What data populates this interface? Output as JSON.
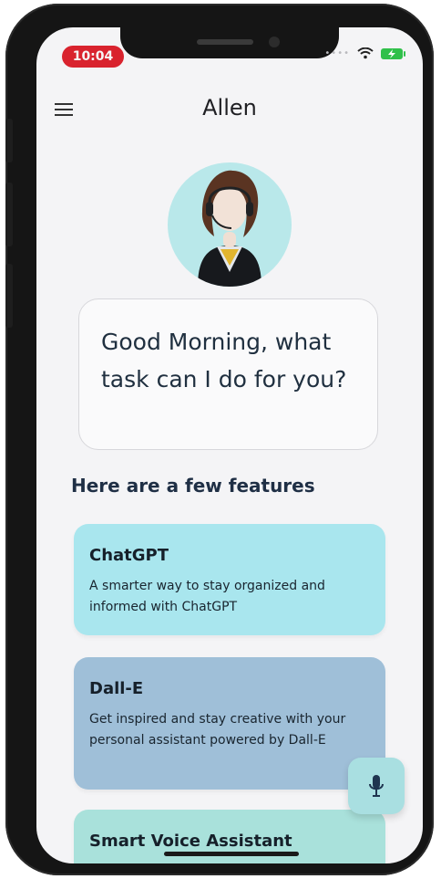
{
  "status_bar": {
    "time": "10:04",
    "battery_color": "#30C04A",
    "time_pill_color": "#D9232E",
    "icons": [
      "cellular-dots-icon",
      "wifi-icon",
      "battery-charging-icon"
    ]
  },
  "header": {
    "menu_icon": "hamburger-menu-icon",
    "title": "Allen"
  },
  "assistant": {
    "avatar_icon": "assistant-avatar-icon",
    "greeting": "Good Morning, what task can I do for you?"
  },
  "features": {
    "heading": "Here are a few features",
    "items": [
      {
        "title": "ChatGPT",
        "description": "A smarter way to stay organized and informed with ChatGPT",
        "color": "#A9E6EE"
      },
      {
        "title": "Dall-E",
        "description": "Get inspired and stay creative with your personal assistant powered by Dall-E",
        "color": "#9FBFD8"
      },
      {
        "title": "Smart Voice Assistant",
        "description": "",
        "color": "#A9E1DB"
      }
    ]
  },
  "mic_button": {
    "icon": "microphone-icon",
    "color": "#A9DFE1"
  }
}
